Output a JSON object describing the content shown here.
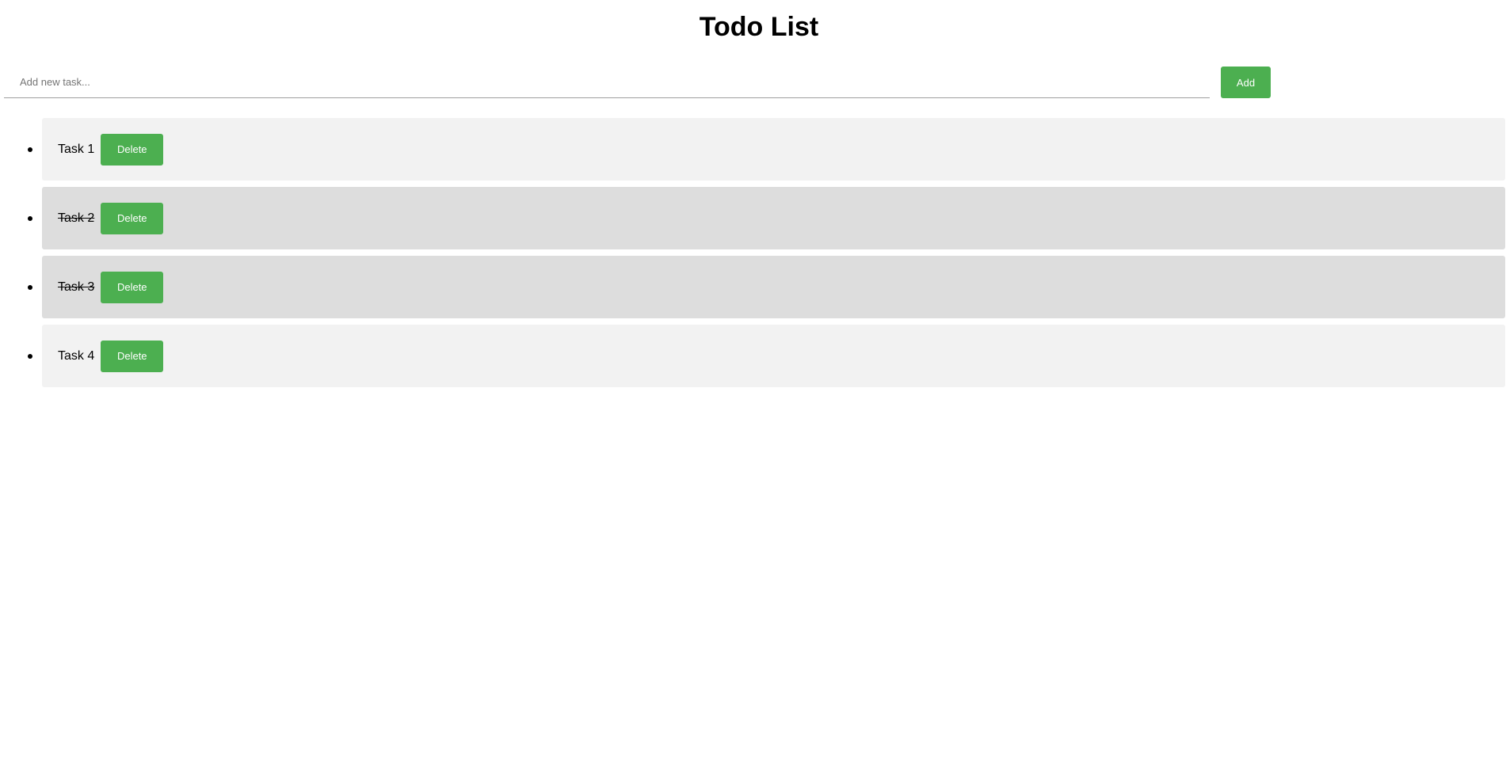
{
  "app": {
    "title": "Todo List"
  },
  "new_task": {
    "placeholder": "Add new task...",
    "value": "",
    "add_label": "Add"
  },
  "tasks": [
    {
      "label": "Task 1",
      "completed": false,
      "delete_label": "Delete"
    },
    {
      "label": "Task 2",
      "completed": true,
      "delete_label": "Delete"
    },
    {
      "label": "Task 3",
      "completed": true,
      "delete_label": "Delete"
    },
    {
      "label": "Task 4",
      "completed": false,
      "delete_label": "Delete"
    }
  ],
  "colors": {
    "accent": "#4caf50",
    "item_background": "#f2f2f2",
    "completed_item_background": "#dddddd"
  }
}
